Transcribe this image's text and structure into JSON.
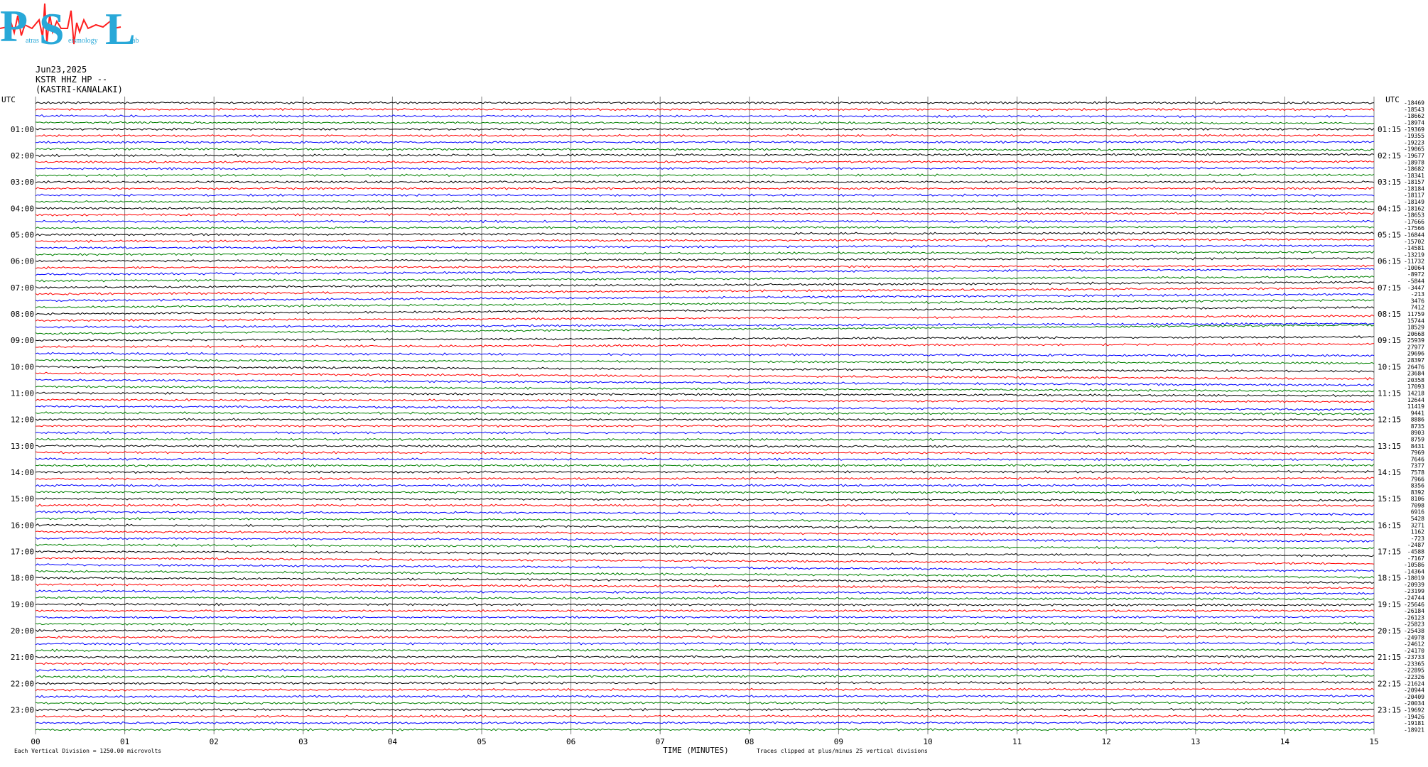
{
  "logo": {
    "big_letters": [
      "P",
      "S",
      "L"
    ],
    "small_words": [
      "atras",
      "eismology",
      "ab"
    ],
    "colors": {
      "letters": "#28a8d8",
      "trace": "#ff2020"
    }
  },
  "header": {
    "date": "Jun23,2025",
    "station": "KSTR HHZ HP --",
    "location": "(KASTRI-KANALAKI)"
  },
  "chart_data": {
    "type": "line",
    "title": "",
    "left_axis_label": "UTC",
    "right_axis_label": "UTC",
    "left_hour_labels": [
      "01:00",
      "02:00",
      "03:00",
      "04:00",
      "05:00",
      "06:00",
      "07:00",
      "08:00",
      "09:00",
      "10:00",
      "11:00",
      "12:00",
      "13:00",
      "14:00",
      "15:00",
      "16:00",
      "17:00",
      "18:00",
      "19:00",
      "20:00",
      "21:00",
      "22:00",
      "23:00"
    ],
    "right_hour_labels": [
      "01:15",
      "02:15",
      "03:15",
      "04:15",
      "05:15",
      "06:15",
      "07:15",
      "08:15",
      "09:15",
      "10:15",
      "11:15",
      "12:15",
      "13:15",
      "14:15",
      "15:15",
      "16:15",
      "17:15",
      "18:15",
      "19:15",
      "20:15",
      "21:15",
      "22:15",
      "23:15"
    ],
    "x_ticks": [
      "00",
      "01",
      "02",
      "03",
      "04",
      "05",
      "06",
      "07",
      "08",
      "09",
      "10",
      "11",
      "12",
      "13",
      "14",
      "15"
    ],
    "xlabel": "TIME (MINUTES)",
    "xlim": [
      0,
      15
    ],
    "trace_colors": [
      "#000000",
      "#ff0000",
      "#0000ff",
      "#008000"
    ],
    "traces_per_hour": 4,
    "trace_offsets": [
      -18469,
      -18543,
      -18662,
      -18974,
      -19369,
      -19355,
      -19223,
      -19065,
      -19677,
      -18978,
      -18682,
      -18341,
      -18157,
      -18184,
      -18117,
      -18149,
      -18162,
      -18653,
      -17666,
      -17566,
      -16844,
      -15702,
      -14581,
      -13219,
      -11732,
      -10064,
      -8972,
      -5844,
      -3447,
      -213,
      3476,
      7412,
      11759,
      15744,
      18529,
      20668,
      25939,
      27977,
      29696,
      28397,
      26476,
      23684,
      20358,
      17093,
      14218,
      12644,
      11419,
      9441,
      8886,
      8735,
      8903,
      8759,
      8431,
      7969,
      7646,
      7377,
      7578,
      7966,
      8356,
      8392,
      8106,
      7098,
      6916,
      5428,
      3271,
      1162,
      -723,
      -2487,
      -4588,
      -7167,
      -10586,
      -14364,
      -18019,
      -20939,
      -23199,
      -24744,
      -25646,
      -26184,
      -26123,
      -25823,
      -25438,
      -24978,
      -24612,
      -24170,
      -23733,
      -23365,
      -22895,
      -22326,
      -21624,
      -20944,
      -20409,
      -20034,
      -19692,
      -19426,
      -19181,
      -18921
    ],
    "footer_left": "Each Vertical Division = 1250.00 microvolts",
    "footer_right": "Traces clipped at plus/minus 25 vertical divisions",
    "grid": true
  }
}
